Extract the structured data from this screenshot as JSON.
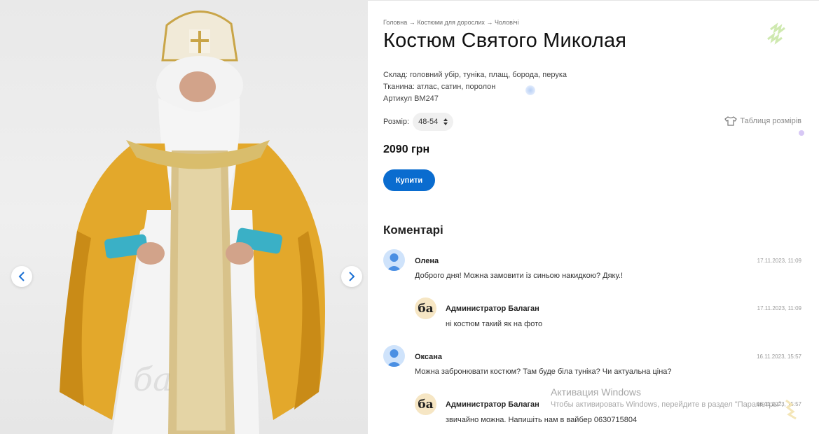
{
  "gallery": {
    "image_description_alt": "",
    "watermark": "ба",
    "prev_icon": "chevron-left-icon",
    "next_icon": "chevron-right-icon"
  },
  "breadcrumb": {
    "items": [
      "Головна",
      "Костюми для дорослих",
      "Чоловічі"
    ],
    "separator": "→"
  },
  "product": {
    "title": "Костюм Святого Миколая",
    "composition": "Склад: головний убір, туніка, плащ, борода, перука",
    "fabric": "Тканина: атлас, сатин, поролон",
    "article": "Артикул ВМ247",
    "size_label": "Розмір:",
    "size_value": "48-54",
    "size_table_label": "Таблиця розмірів",
    "price": "2090 грн",
    "buy_label": "Купити"
  },
  "comments": {
    "heading": "Коментарі",
    "items": [
      {
        "name": "Олена",
        "date": "17.11.2023, 11:09",
        "text": "Доброго дня! Можна замовити із синьою накидкою? Дяку.!",
        "avatar": "user-avatar-icon"
      },
      {
        "name": "Администратор Балаган",
        "date": "17.11.2023, 11:09",
        "text": "ні костюм такий як на фото",
        "avatar": "ба"
      },
      {
        "name": "Оксана",
        "date": "16.11.2023, 15:57",
        "text": "Можна забронювати костюм? Там буде біла туніка? Чи актуальна ціна?",
        "avatar": "user-avatar-icon"
      },
      {
        "name": "Администратор Балаган",
        "date": "16.11.2023, 15:57",
        "text": "звичайно можна. Напишіть нам в вайбер 0630715804",
        "avatar": "ба"
      }
    ]
  },
  "windows_activation": {
    "title": "Активация Windows",
    "subtitle": "Чтобы активировать Windows, перейдите в раздел \"Параметры\"."
  },
  "colors": {
    "accent": "#0a6ccf",
    "gold": "#e0a52a",
    "avatar_user_bg": "#cfe3fb",
    "avatar_admin_bg": "#f6e6c4"
  }
}
